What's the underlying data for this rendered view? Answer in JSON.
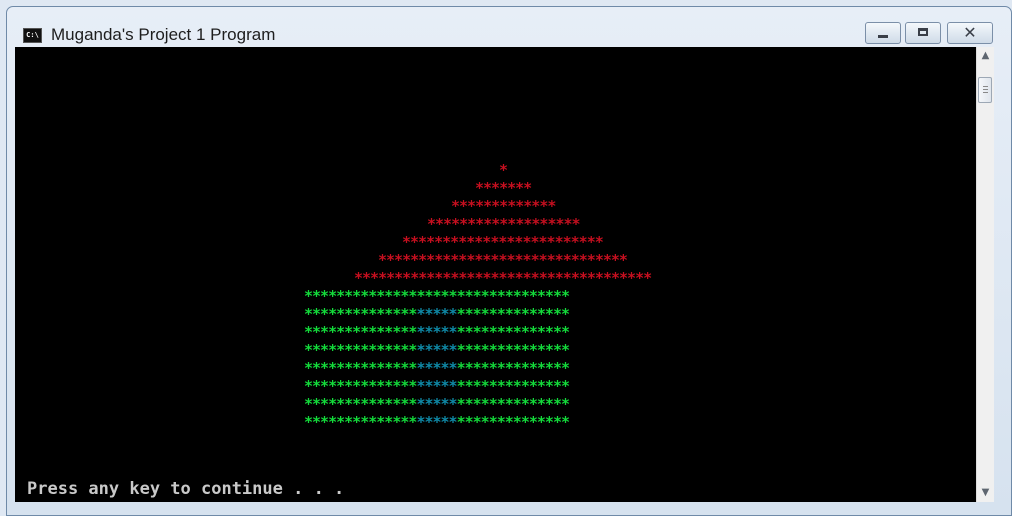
{
  "window": {
    "title": "Muganda's Project 1 Program",
    "icon_label": "C:\\"
  },
  "console": {
    "roof": [
      "*",
      "*******",
      "*************",
      "*******************",
      "*************************",
      "*******************************",
      "*************************************"
    ],
    "walls": {
      "left": "**************",
      "door": "*****",
      "right": "**************",
      "rows": 8
    },
    "prompt": "Press any key to continue . . ."
  },
  "colors": {
    "roof": "#c50f1f",
    "walls": "#13d93a",
    "door": "#0f8aa8",
    "background": "#000000"
  },
  "scrollbar": {
    "up_icon": "scroll-up-arrow-icon",
    "down_icon": "scroll-down-arrow-icon"
  }
}
